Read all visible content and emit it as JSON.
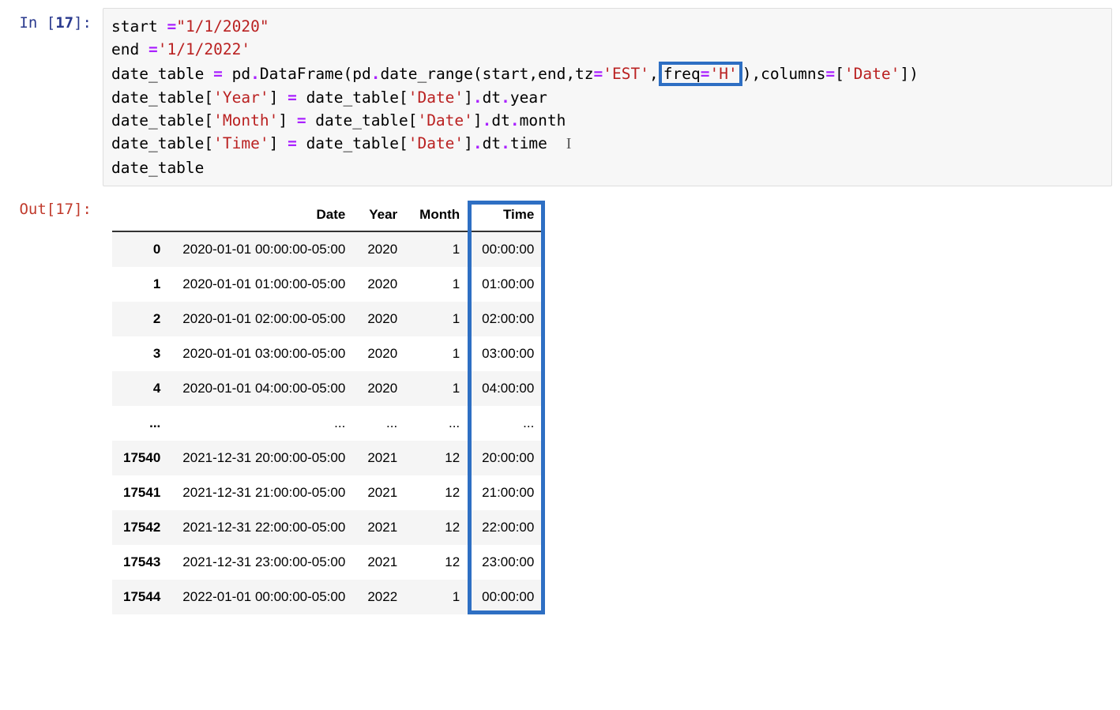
{
  "cell_num": "17",
  "in_label_prefix": "In [",
  "in_label_suffix": "]:",
  "out_prefix": "Out[",
  "out_suffix": "]:",
  "code": {
    "l1_a": "start ",
    "l1_op": "=",
    "l1_str": "\"1/1/2020\"",
    "l2_a": "end ",
    "l2_op": "=",
    "l2_str": "'1/1/2022'",
    "l3_a": "date_table ",
    "l3_op": "=",
    "l3_b": " pd",
    "l3_op2": ".",
    "l3_c": "DataFrame(pd",
    "l3_op3": ".",
    "l3_d": "date_range(start,end,tz",
    "l3_op4": "=",
    "l3_tz": "'EST'",
    "l3_e": ",",
    "l3_freq_a": "freq",
    "l3_freq_op": "=",
    "l3_freq_v": "'H'",
    "l3_f": "),columns",
    "l3_op5": "=",
    "l3_g": "[",
    "l3_datecol": "'Date'",
    "l3_h": "])",
    "l4_a": "date_table[",
    "l4_year": "'Year'",
    "l4_b": "] ",
    "l4_op": "=",
    "l4_c": " date_table[",
    "l4_date": "'Date'",
    "l4_d": "]",
    "l4_op2": ".",
    "l4_e": "dt",
    "l4_op3": ".",
    "l4_f": "year",
    "l5_a": "date_table[",
    "l5_month": "'Month'",
    "l5_b": "] ",
    "l5_op": "=",
    "l5_c": " date_table[",
    "l5_date": "'Date'",
    "l5_d": "]",
    "l5_op2": ".",
    "l5_e": "dt",
    "l5_op3": ".",
    "l5_f": "month",
    "l6_a": "date_table[",
    "l6_time": "'Time'",
    "l6_b": "] ",
    "l6_op": "=",
    "l6_c": " date_table[",
    "l6_date": "'Date'",
    "l6_d": "]",
    "l6_op2": ".",
    "l6_e": "dt",
    "l6_op3": ".",
    "l6_f": "time",
    "l7": "date_table"
  },
  "cursor": "I",
  "table": {
    "headers": [
      "",
      "Date",
      "Year",
      "Month",
      "Time"
    ],
    "rows": [
      {
        "idx": "0",
        "date": "2020-01-01 00:00:00-05:00",
        "year": "2020",
        "month": "1",
        "time": "00:00:00"
      },
      {
        "idx": "1",
        "date": "2020-01-01 01:00:00-05:00",
        "year": "2020",
        "month": "1",
        "time": "01:00:00"
      },
      {
        "idx": "2",
        "date": "2020-01-01 02:00:00-05:00",
        "year": "2020",
        "month": "1",
        "time": "02:00:00"
      },
      {
        "idx": "3",
        "date": "2020-01-01 03:00:00-05:00",
        "year": "2020",
        "month": "1",
        "time": "03:00:00"
      },
      {
        "idx": "4",
        "date": "2020-01-01 04:00:00-05:00",
        "year": "2020",
        "month": "1",
        "time": "04:00:00"
      },
      {
        "idx": "...",
        "date": "...",
        "year": "...",
        "month": "...",
        "time": "..."
      },
      {
        "idx": "17540",
        "date": "2021-12-31 20:00:00-05:00",
        "year": "2021",
        "month": "12",
        "time": "20:00:00"
      },
      {
        "idx": "17541",
        "date": "2021-12-31 21:00:00-05:00",
        "year": "2021",
        "month": "12",
        "time": "21:00:00"
      },
      {
        "idx": "17542",
        "date": "2021-12-31 22:00:00-05:00",
        "year": "2021",
        "month": "12",
        "time": "22:00:00"
      },
      {
        "idx": "17543",
        "date": "2021-12-31 23:00:00-05:00",
        "year": "2021",
        "month": "12",
        "time": "23:00:00"
      },
      {
        "idx": "17544",
        "date": "2022-01-01 00:00:00-05:00",
        "year": "2022",
        "month": "1",
        "time": "00:00:00"
      }
    ]
  }
}
